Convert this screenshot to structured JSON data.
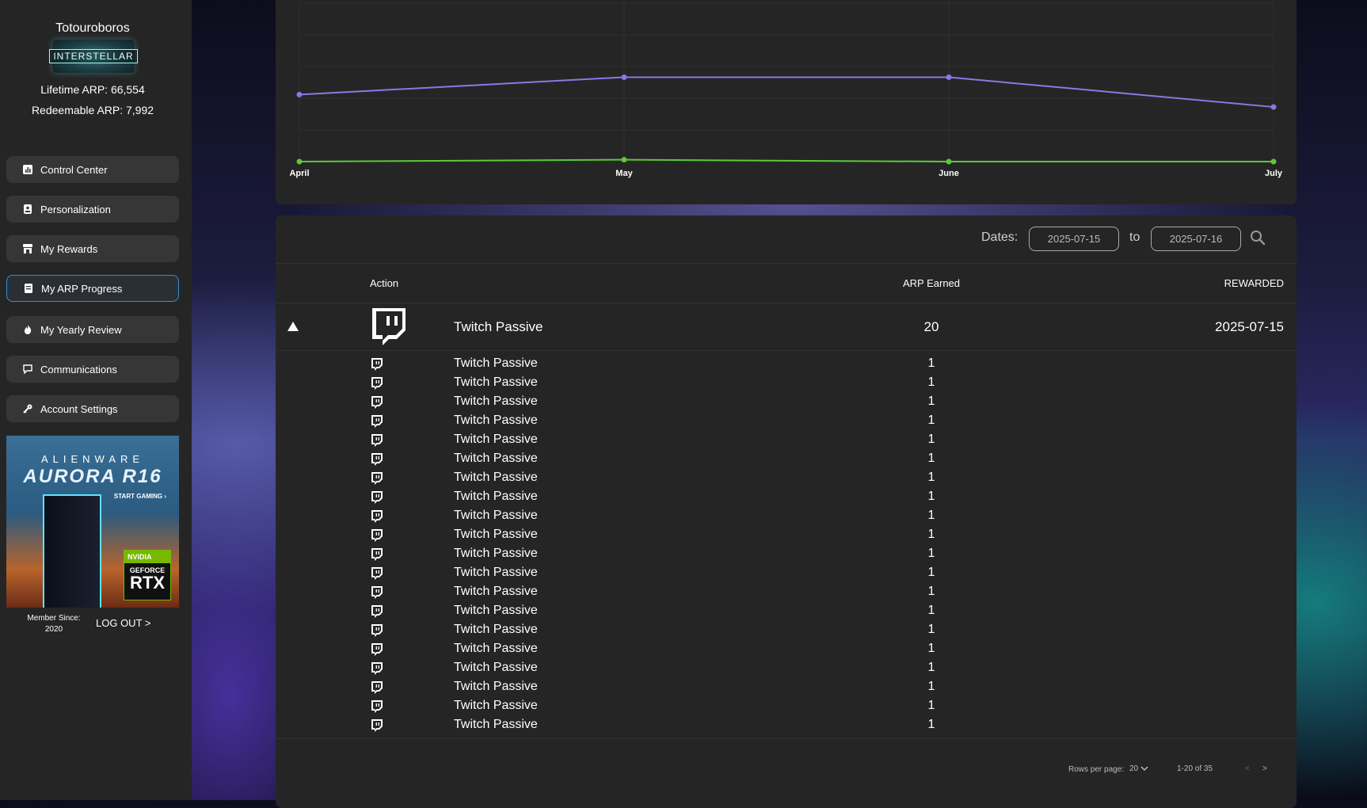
{
  "profile": {
    "username": "Totouroboros",
    "guild_logo_text": "INTERSTELLAR",
    "lifetime_arp": "Lifetime ARP: 66,554",
    "redeemable_arp": "Redeemable ARP: 7,992"
  },
  "nav": [
    {
      "label": "Control Center",
      "icon": "chart-icon"
    },
    {
      "label": "Personalization",
      "icon": "id-card-icon"
    },
    {
      "label": "My Rewards",
      "icon": "store-icon"
    },
    {
      "label": "My ARP Progress",
      "icon": "book-icon",
      "active": true
    },
    {
      "label": "My Yearly Review",
      "icon": "fire-icon"
    },
    {
      "label": "Communications",
      "icon": "chat-icon"
    },
    {
      "label": "Account Settings",
      "icon": "key-icon"
    }
  ],
  "ad": {
    "brand": "ALIENWARE",
    "model": "AURORA R16",
    "cta": "START GAMING ›",
    "nvidia": "NVIDIA",
    "geforce": "GEFORCE",
    "rtx": "RTX"
  },
  "member_since": "Member Since: 2020",
  "logout": "LOG OUT >",
  "colors": {
    "accent_active_border": "#2f8fd6",
    "series_purple": "#8b78e6",
    "series_green": "#5cc83a"
  },
  "chart_data": {
    "type": "line",
    "categories": [
      "April",
      "May",
      "June",
      "July"
    ],
    "series": [
      {
        "color": "#8b78e6",
        "values": [
          5400,
          6800,
          6800,
          4400
        ]
      },
      {
        "color": "#5cc83a",
        "values": [
          0,
          150,
          0,
          0
        ]
      }
    ]
  },
  "filter": {
    "dates_label": "Dates:",
    "from": "2025-07-15",
    "to_label": "to",
    "to": "2025-07-16"
  },
  "table": {
    "headers": {
      "action": "Action",
      "arp": "ARP Earned",
      "rewarded": "REWARDED"
    },
    "main_row": {
      "action": "Twitch Passive",
      "arp": "20",
      "date": "2025-07-15",
      "icon": "twitch-icon"
    },
    "sub_rows": [
      {
        "action": "Twitch Passive",
        "arp": "1"
      },
      {
        "action": "Twitch Passive",
        "arp": "1"
      },
      {
        "action": "Twitch Passive",
        "arp": "1"
      },
      {
        "action": "Twitch Passive",
        "arp": "1"
      },
      {
        "action": "Twitch Passive",
        "arp": "1"
      },
      {
        "action": "Twitch Passive",
        "arp": "1"
      },
      {
        "action": "Twitch Passive",
        "arp": "1"
      },
      {
        "action": "Twitch Passive",
        "arp": "1"
      },
      {
        "action": "Twitch Passive",
        "arp": "1"
      },
      {
        "action": "Twitch Passive",
        "arp": "1"
      },
      {
        "action": "Twitch Passive",
        "arp": "1"
      },
      {
        "action": "Twitch Passive",
        "arp": "1"
      },
      {
        "action": "Twitch Passive",
        "arp": "1"
      },
      {
        "action": "Twitch Passive",
        "arp": "1"
      },
      {
        "action": "Twitch Passive",
        "arp": "1"
      },
      {
        "action": "Twitch Passive",
        "arp": "1"
      },
      {
        "action": "Twitch Passive",
        "arp": "1"
      },
      {
        "action": "Twitch Passive",
        "arp": "1"
      },
      {
        "action": "Twitch Passive",
        "arp": "1"
      },
      {
        "action": "Twitch Passive",
        "arp": "1"
      }
    ]
  },
  "pager": {
    "rows_label": "Rows per page:",
    "rows_value": "20",
    "range": "1-20 of 35",
    "prev": "<",
    "next": ">"
  }
}
